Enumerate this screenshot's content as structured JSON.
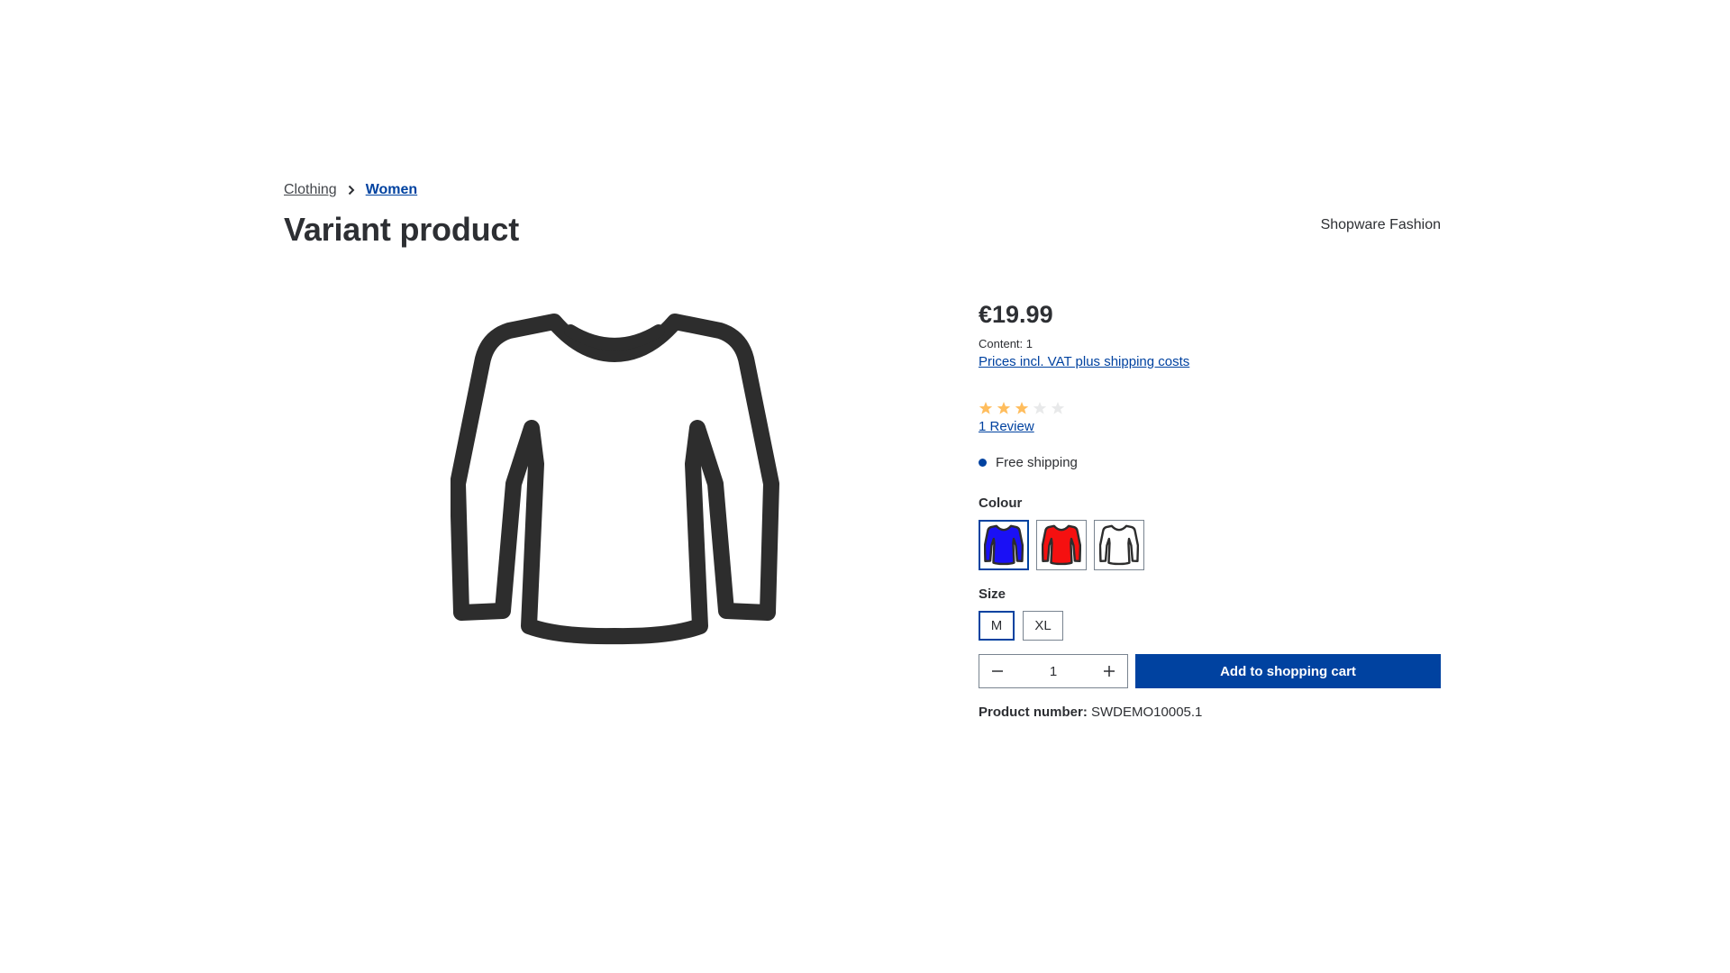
{
  "breadcrumb": {
    "items": [
      "Clothing",
      "Women"
    ]
  },
  "product": {
    "title": "Variant product",
    "manufacturer": "Shopware Fashion",
    "price": "€19.99",
    "content": "Content: 1",
    "vat_link": "Prices incl. VAT plus shipping costs",
    "rating": {
      "value": 3,
      "max": 5
    },
    "review_link": "1 Review",
    "delivery": "Free shipping",
    "colour_label": "Colour",
    "colours": [
      {
        "name": "blue",
        "fill": "#1a10f5",
        "selected": true
      },
      {
        "name": "red",
        "fill": "#f51010",
        "selected": false
      },
      {
        "name": "white",
        "fill": "#ffffff",
        "selected": false
      }
    ],
    "size_label": "Size",
    "sizes": [
      {
        "label": "M",
        "selected": true
      },
      {
        "label": "XL",
        "selected": false
      }
    ],
    "quantity": "1",
    "add_to_cart": "Add to shopping cart",
    "product_number_label": "Product number:",
    "product_number": "SWDEMO10005.1"
  },
  "colors": {
    "accent": "#0042a0",
    "text": "#2d2f33",
    "star_filled": "#ffbd5d",
    "star_empty": "#e8e9ea"
  }
}
